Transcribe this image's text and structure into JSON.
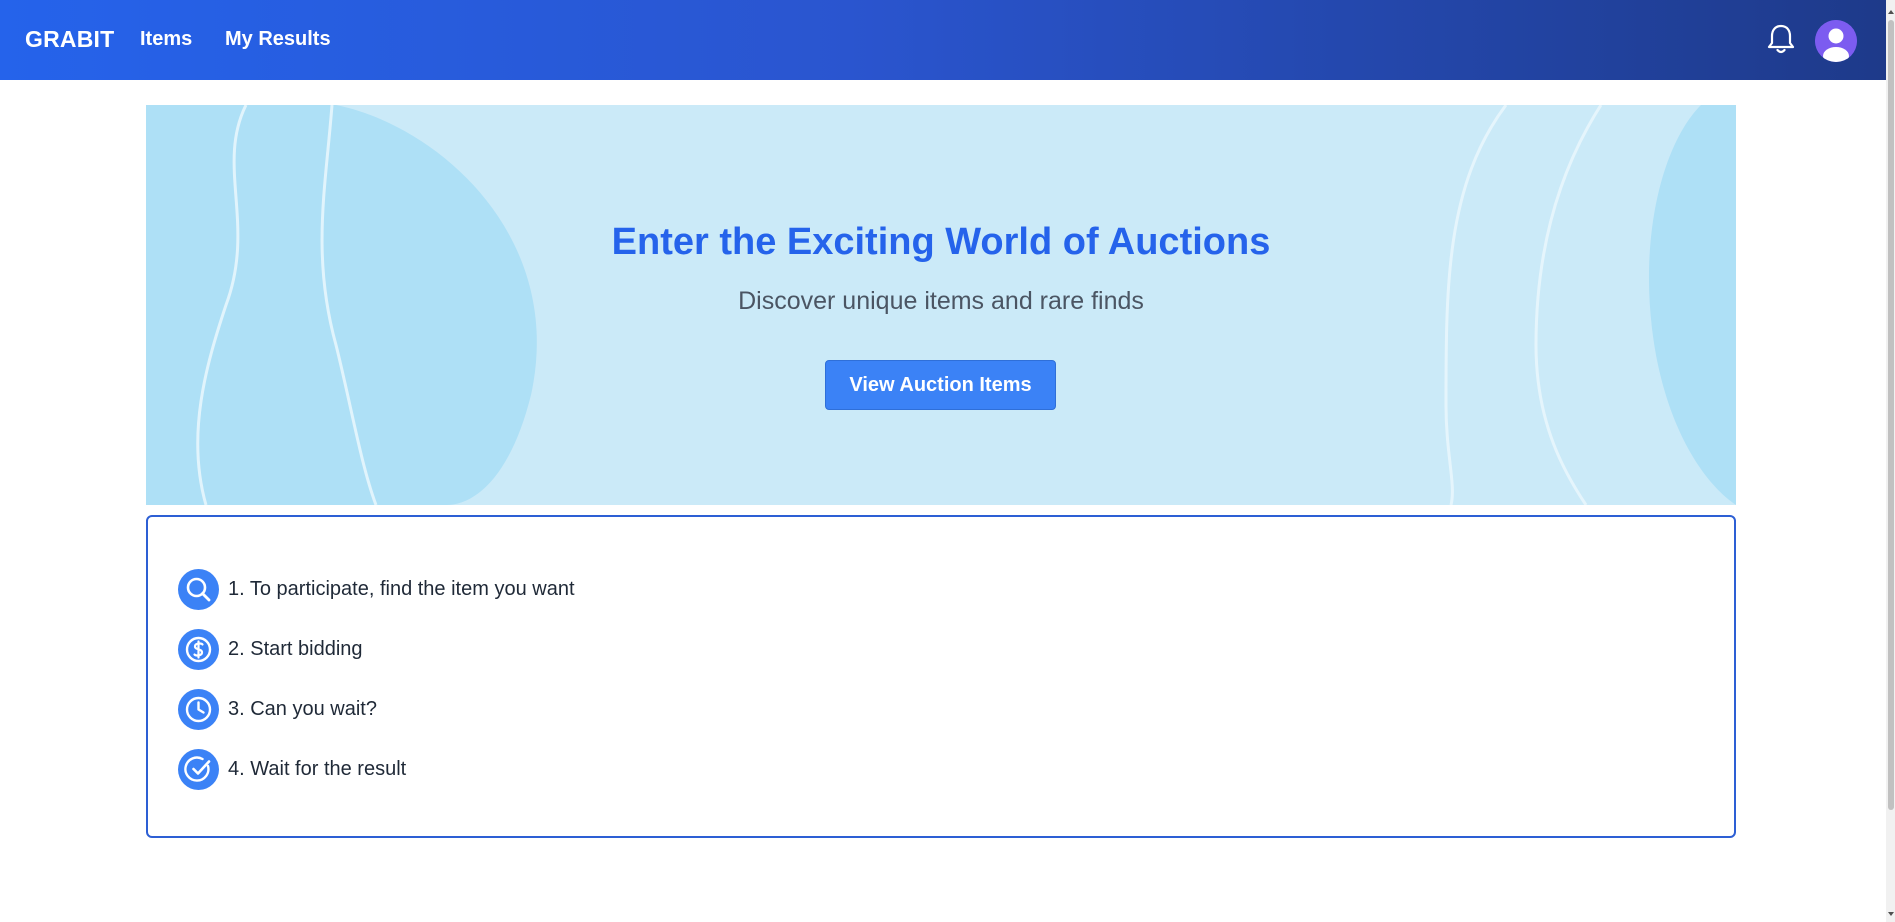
{
  "navbar": {
    "brand": "GRABIT",
    "links": [
      "Items",
      "My Results"
    ],
    "icons": {
      "notifications": "bell-icon",
      "profile": "user-avatar-icon"
    },
    "gradient_colors": [
      "#2563eb",
      "#1e3a8a"
    ]
  },
  "hero": {
    "title": "Enter the Exciting World of Auctions",
    "subtitle": "Discover unique items and rare finds",
    "button_label": "View Auction Items",
    "background_color": "#cbeaf8",
    "title_color": "#2563eb",
    "button_color": "#3b82f6"
  },
  "steps": {
    "items": [
      {
        "text": "1. To participate, find the item you want",
        "icon": "search-icon"
      },
      {
        "text": "2. Start bidding",
        "icon": "dollar-coin-icon"
      },
      {
        "text": "3. Can you wait?",
        "icon": "clock-icon"
      },
      {
        "text": "4. Wait for the result",
        "icon": "check-circle-icon"
      }
    ],
    "border_color": "#2d5fd4",
    "icon_color": "#3b82f6"
  }
}
